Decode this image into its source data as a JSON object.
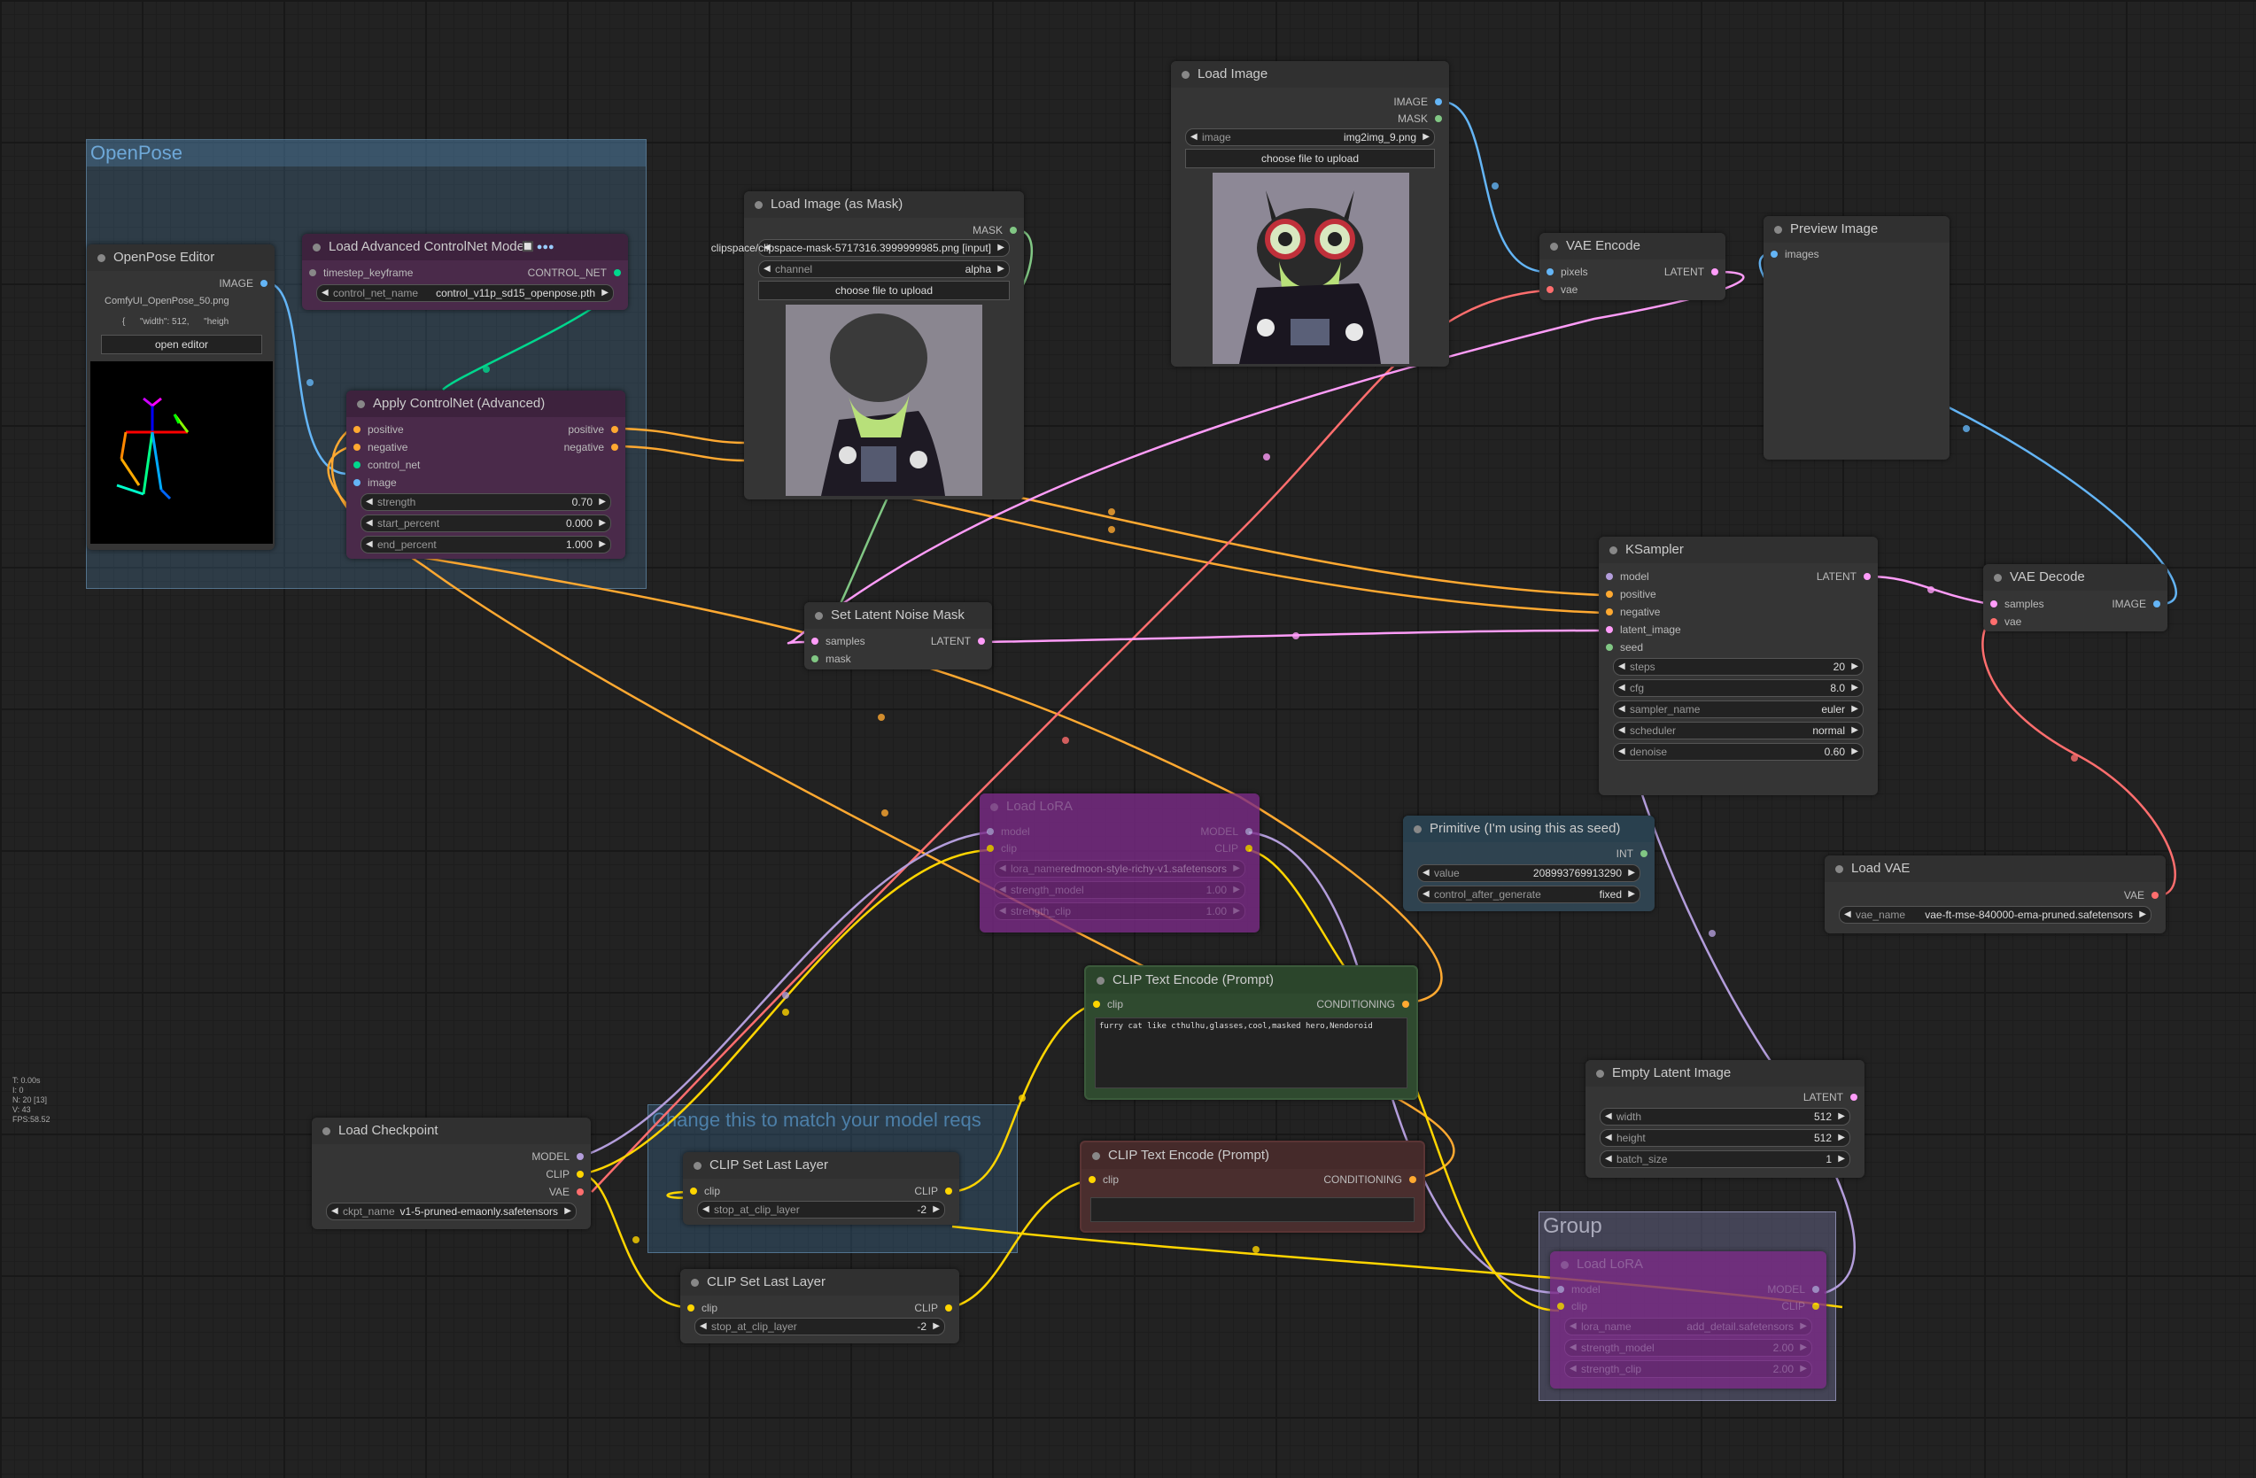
{
  "colors": {
    "model": "#b39ddb",
    "clip": "#ffd500",
    "vae": "#ff6e6e",
    "conditioning": "#ffa931",
    "latent": "#ff9cf9",
    "image": "#64b5f6",
    "mask": "#81c784",
    "control_net": "#00d78d",
    "int": "#29699c"
  },
  "groups": {
    "openpose": {
      "title": "OpenPose"
    },
    "model_reqs": {
      "title": "Change this to match your model reqs"
    },
    "group": {
      "title": "Group"
    }
  },
  "nodes": {
    "openpose_editor": {
      "title": "OpenPose Editor",
      "out_image": "IMAGE",
      "filename": "ComfyUI_OpenPose_50.png",
      "json_preview": "{      \"width\": 512,      \"heigh",
      "button": "open editor"
    },
    "load_cn": {
      "title": "Load Advanced ControlNet Model",
      "in_ts": "timestep_keyframe",
      "out": "CONTROL_NET",
      "w_label": "control_net_name",
      "w_value": "control_v11p_sd15_openpose.pth"
    },
    "apply_cn": {
      "title": "Apply ControlNet (Advanced)",
      "in_positive": "positive",
      "in_negative": "negative",
      "in_control_net": "control_net",
      "in_image": "image",
      "out_positive": "positive",
      "out_negative": "negative",
      "widgets": [
        {
          "label": "strength",
          "value": "0.70"
        },
        {
          "label": "start_percent",
          "value": "0.000"
        },
        {
          "label": "end_percent",
          "value": "1.000"
        }
      ]
    },
    "load_mask": {
      "title": "Load Image (as Mask)",
      "out": "MASK",
      "w_image": "clipspace/clipspace-mask-5717316.3999999985.png [input]",
      "w_channel_label": "channel",
      "w_channel": "alpha",
      "button": "choose file to upload"
    },
    "load_image": {
      "title": "Load Image",
      "out_image": "IMAGE",
      "out_mask": "MASK",
      "w_label": "image",
      "w_value": "img2img_9.png",
      "button": "choose file to upload"
    },
    "vae_encode": {
      "title": "VAE Encode",
      "in_pixels": "pixels",
      "in_vae": "vae",
      "out": "LATENT"
    },
    "preview": {
      "title": "Preview Image",
      "in": "images"
    },
    "set_mask": {
      "title": "Set Latent Noise Mask",
      "in_samples": "samples",
      "in_mask": "mask",
      "out": "LATENT"
    },
    "ksampler": {
      "title": "KSampler",
      "in": [
        "model",
        "positive",
        "negative",
        "latent_image",
        "seed"
      ],
      "out": "LATENT",
      "widgets": [
        {
          "label": "steps",
          "value": "20"
        },
        {
          "label": "cfg",
          "value": "8.0"
        },
        {
          "label": "sampler_name",
          "value": "euler"
        },
        {
          "label": "scheduler",
          "value": "normal"
        },
        {
          "label": "denoise",
          "value": "0.60"
        }
      ]
    },
    "vae_decode": {
      "title": "VAE Decode",
      "in_samples": "samples",
      "in_vae": "vae",
      "out": "IMAGE"
    },
    "primitive": {
      "title": "Primitive (I'm using this as seed)",
      "out": "INT",
      "widgets": [
        {
          "label": "value",
          "value": "208993769913290"
        },
        {
          "label": "control_after_generate",
          "value": "fixed"
        }
      ]
    },
    "load_vae": {
      "title": "Load VAE",
      "out": "VAE",
      "w_label": "vae_name",
      "w_value": "vae-ft-mse-840000-ema-pruned.safetensors"
    },
    "lora1": {
      "title": "Load LoRA",
      "in_model": "model",
      "in_clip": "clip",
      "out_model": "MODEL",
      "out_clip": "CLIP",
      "widgets": [
        {
          "label": "lora_name",
          "value": "redmoon-style-richy-v1.safetensors"
        },
        {
          "label": "strength_model",
          "value": "1.00"
        },
        {
          "label": "strength_clip",
          "value": "1.00"
        }
      ]
    },
    "clip_pos": {
      "title": "CLIP Text Encode (Prompt)",
      "in": "clip",
      "out": "CONDITIONING",
      "text": "furry cat like cthulhu,glasses,cool,masked hero,Nendoroid"
    },
    "clip_neg": {
      "title": "CLIP Text Encode (Prompt)",
      "in": "clip",
      "out": "CONDITIONING",
      "text": ""
    },
    "empty_latent": {
      "title": "Empty Latent Image",
      "out": "LATENT",
      "widgets": [
        {
          "label": "width",
          "value": "512"
        },
        {
          "label": "height",
          "value": "512"
        },
        {
          "label": "batch_size",
          "value": "1"
        }
      ]
    },
    "load_ckpt": {
      "title": "Load Checkpoint",
      "out_model": "MODEL",
      "out_clip": "CLIP",
      "out_vae": "VAE",
      "w_label": "ckpt_name",
      "w_value": "v1-5-pruned-emaonly.safetensors"
    },
    "clip_last1": {
      "title": "CLIP Set Last Layer",
      "in": "clip",
      "out": "CLIP",
      "w_label": "stop_at_clip_layer",
      "w_value": "-2"
    },
    "clip_last2": {
      "title": "CLIP Set Last Layer",
      "in": "clip",
      "out": "CLIP",
      "w_label": "stop_at_clip_layer",
      "w_value": "-2"
    },
    "lora2": {
      "title": "Load LoRA",
      "in_model": "model",
      "in_clip": "clip",
      "out_model": "MODEL",
      "out_clip": "CLIP",
      "widgets": [
        {
          "label": "lora_name",
          "value": "add_detail.safetensors"
        },
        {
          "label": "strength_model",
          "value": "2.00"
        },
        {
          "label": "strength_clip",
          "value": "2.00"
        }
      ]
    }
  },
  "stats": {
    "t": "T: 0.00s",
    "i": "I: 0",
    "n": "N: 20 [13]",
    "v": "V: 43",
    "fps": "FPS:58.52"
  }
}
